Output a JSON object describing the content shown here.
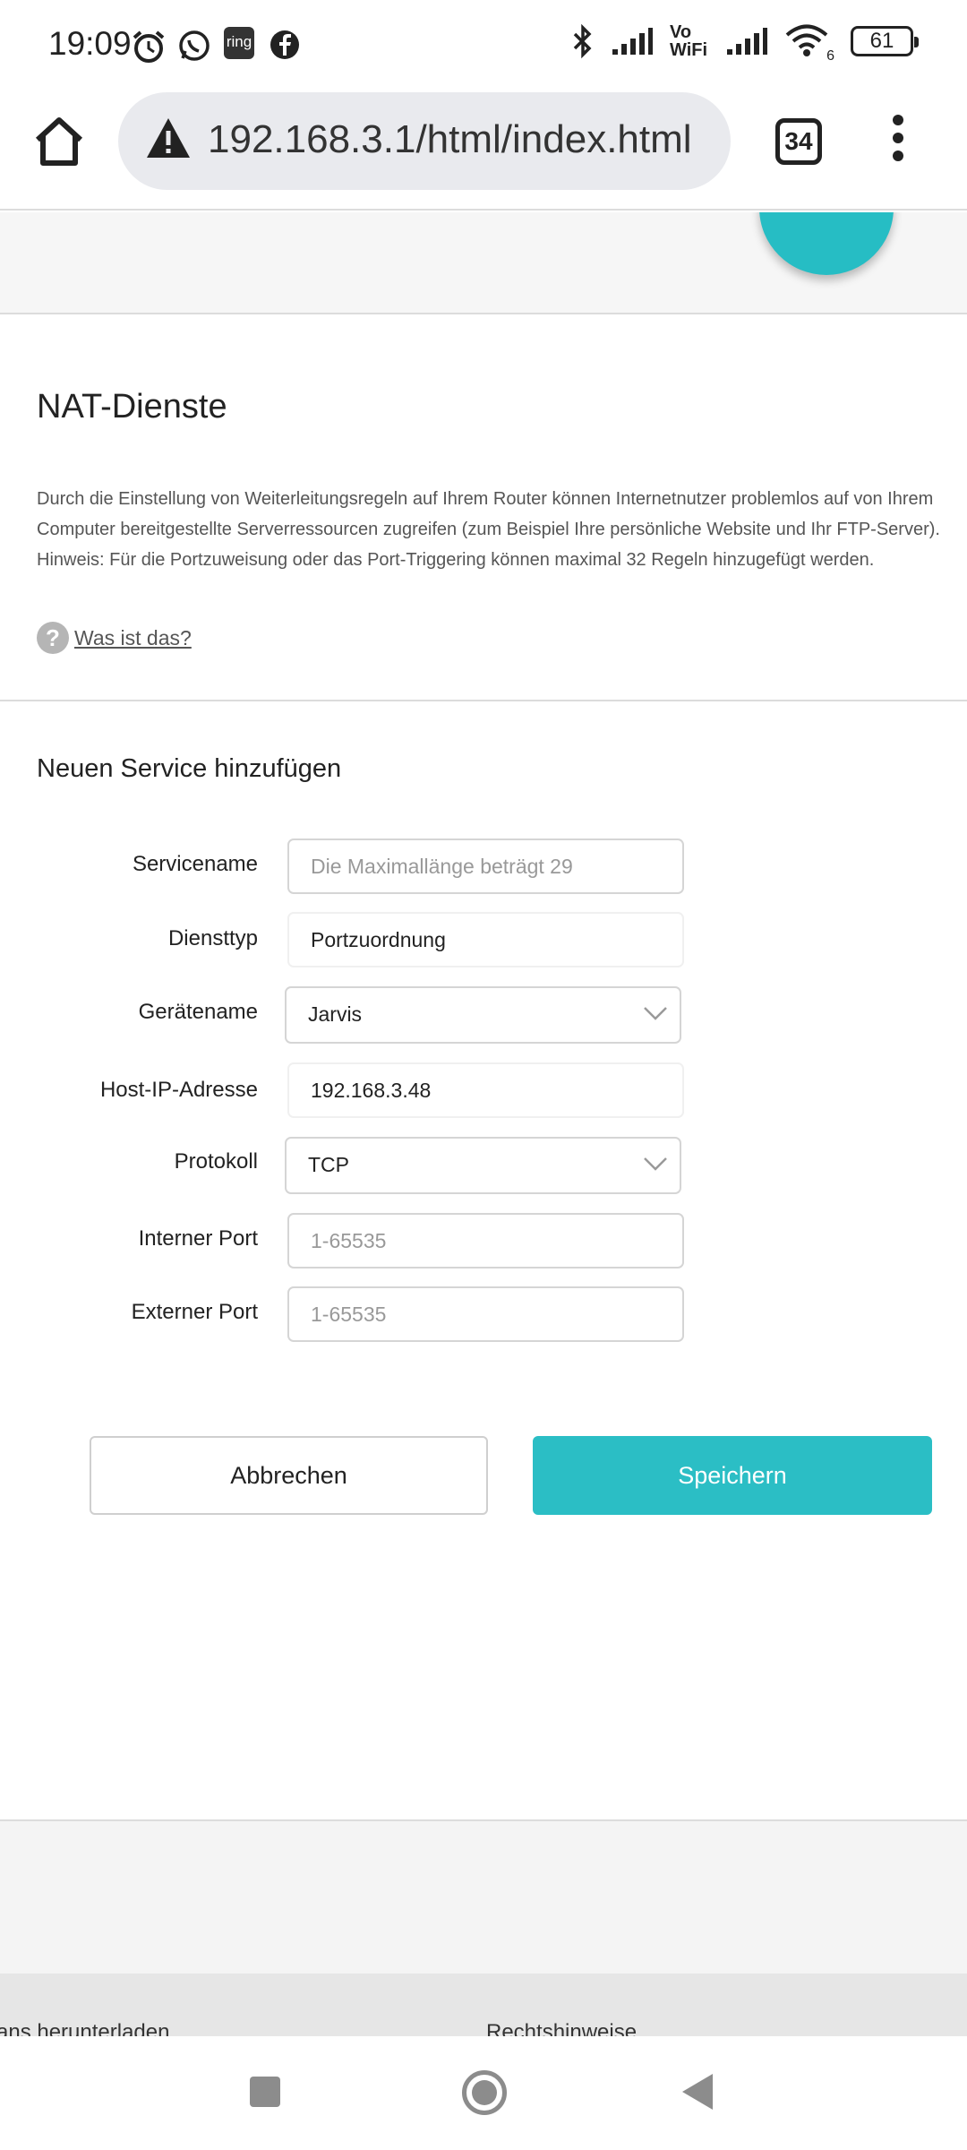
{
  "status_bar": {
    "time": "19:09",
    "icons": [
      "alarm-icon",
      "whatsapp-icon",
      "ring-icon",
      "facebook-icon",
      "bluetooth-icon",
      "signal-icon",
      "vowifi-icon",
      "signal-icon",
      "wifi-icon"
    ],
    "ring_label": "ring",
    "vowifi_label": "Vo WiFi",
    "wifi_label": "6",
    "battery": "61"
  },
  "browser": {
    "url": "192.168.3.1/html/index.html",
    "tab_count": "34"
  },
  "page": {
    "section_title": "NAT-Dienste",
    "description_line1": "Durch die Einstellung von Weiterleitungsregeln auf Ihrem Router können Internetnutzer problemlos auf von Ihrem",
    "description_line2": "Computer bereitgestellte Serverressourcen zugreifen (zum Beispiel Ihre persönliche Website und Ihr FTP-Server).",
    "description_line3": "Hinweis: Für die Portzuweisung oder das Port-Triggering können maximal 32 Regeln hinzugefügt werden.",
    "help_link": "Was ist das?",
    "help_icon": "?",
    "form_title": "Neuen Service hinzufügen",
    "form": {
      "service_name": {
        "label": "Servicename",
        "placeholder": "Die Maximallänge beträgt 29",
        "value": ""
      },
      "service_type": {
        "label": "Diensttyp",
        "value": "Portzuordnung"
      },
      "device_name": {
        "label": "Gerätename",
        "value": "Jarvis"
      },
      "host_ip": {
        "label": "Host-IP-Adresse",
        "value": "192.168.3.48"
      },
      "protocol": {
        "label": "Protokoll",
        "value": "TCP"
      },
      "internal_port": {
        "label": "Interner Port",
        "placeholder": "1-65535",
        "value": ""
      },
      "external_port": {
        "label": "Externer Port",
        "placeholder": "1-65535",
        "value": ""
      }
    },
    "buttons": {
      "cancel": "Abbrechen",
      "save": "Speichern"
    },
    "footer_links": [
      "ans herunterladen",
      "Rechtshinweise"
    ]
  },
  "colors": {
    "accent": "#2bbec5",
    "background_grey": "#f6f6f6"
  }
}
